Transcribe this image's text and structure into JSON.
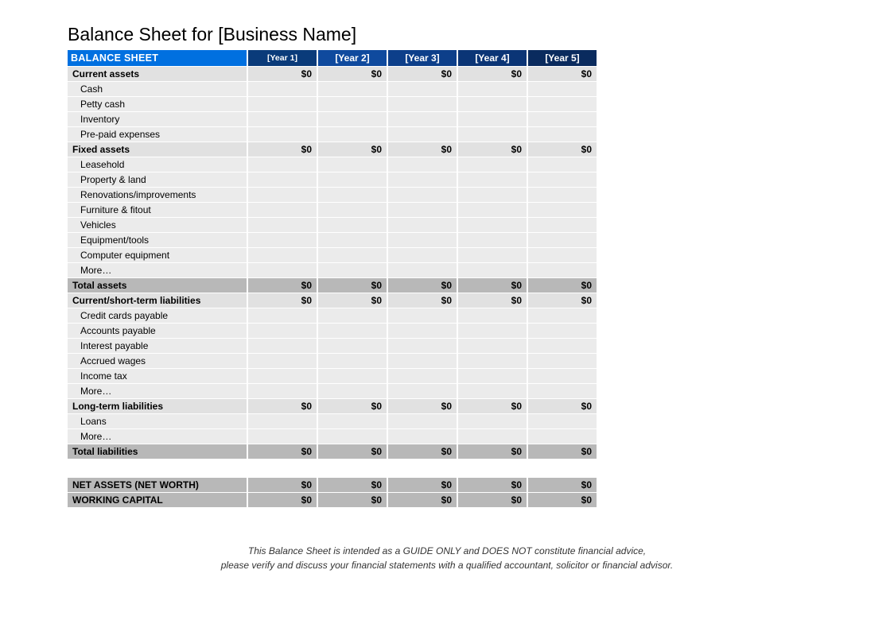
{
  "title": "Balance Sheet for [Business Name]",
  "header": {
    "main": "BALANCE SHEET",
    "years": [
      "[Year 1]",
      "[Year 2]",
      "[Year 3]",
      "[Year 4]",
      "[Year 5]"
    ]
  },
  "rows": [
    {
      "type": "section",
      "label": "Current assets",
      "values": [
        "$0",
        "$0",
        "$0",
        "$0",
        "$0"
      ]
    },
    {
      "type": "item",
      "label": "Cash",
      "values": [
        "",
        "",
        "",
        "",
        ""
      ]
    },
    {
      "type": "item",
      "label": "Petty cash",
      "values": [
        "",
        "",
        "",
        "",
        ""
      ]
    },
    {
      "type": "item",
      "label": "Inventory",
      "values": [
        "",
        "",
        "",
        "",
        ""
      ]
    },
    {
      "type": "item",
      "label": "Pre-paid expenses",
      "values": [
        "",
        "",
        "",
        "",
        ""
      ]
    },
    {
      "type": "section",
      "label": "Fixed assets",
      "values": [
        "$0",
        "$0",
        "$0",
        "$0",
        "$0"
      ]
    },
    {
      "type": "item",
      "label": "Leasehold",
      "values": [
        "",
        "",
        "",
        "",
        ""
      ]
    },
    {
      "type": "item",
      "label": "Property & land",
      "values": [
        "",
        "",
        "",
        "",
        ""
      ]
    },
    {
      "type": "item",
      "label": "Renovations/improvements",
      "values": [
        "",
        "",
        "",
        "",
        ""
      ]
    },
    {
      "type": "item",
      "label": "Furniture & fitout",
      "values": [
        "",
        "",
        "",
        "",
        ""
      ]
    },
    {
      "type": "item",
      "label": "Vehicles",
      "values": [
        "",
        "",
        "",
        "",
        ""
      ]
    },
    {
      "type": "item",
      "label": "Equipment/tools",
      "values": [
        "",
        "",
        "",
        "",
        ""
      ]
    },
    {
      "type": "item",
      "label": "Computer equipment",
      "values": [
        "",
        "",
        "",
        "",
        ""
      ]
    },
    {
      "type": "item",
      "label": "More…",
      "values": [
        "",
        "",
        "",
        "",
        ""
      ]
    },
    {
      "type": "total",
      "label": "Total assets",
      "values": [
        "$0",
        "$0",
        "$0",
        "$0",
        "$0"
      ]
    },
    {
      "type": "section",
      "label": "Current/short-term liabilities",
      "values": [
        "$0",
        "$0",
        "$0",
        "$0",
        "$0"
      ]
    },
    {
      "type": "item",
      "label": "Credit cards payable",
      "values": [
        "",
        "",
        "",
        "",
        ""
      ]
    },
    {
      "type": "item",
      "label": "Accounts payable",
      "values": [
        "",
        "",
        "",
        "",
        ""
      ]
    },
    {
      "type": "item",
      "label": "Interest payable",
      "values": [
        "",
        "",
        "",
        "",
        ""
      ]
    },
    {
      "type": "item",
      "label": "Accrued wages",
      "values": [
        "",
        "",
        "",
        "",
        ""
      ]
    },
    {
      "type": "item",
      "label": "Income tax",
      "values": [
        "",
        "",
        "",
        "",
        ""
      ]
    },
    {
      "type": "item",
      "label": "More…",
      "values": [
        "",
        "",
        "",
        "",
        ""
      ]
    },
    {
      "type": "section",
      "label": "Long-term liabilities",
      "values": [
        "$0",
        "$0",
        "$0",
        "$0",
        "$0"
      ]
    },
    {
      "type": "item",
      "label": "Loans",
      "values": [
        "",
        "",
        "",
        "",
        ""
      ]
    },
    {
      "type": "item",
      "label": "More…",
      "values": [
        "",
        "",
        "",
        "",
        ""
      ]
    },
    {
      "type": "total",
      "label": "Total liabilities",
      "values": [
        "$0",
        "$0",
        "$0",
        "$0",
        "$0"
      ]
    },
    {
      "type": "spacer",
      "label": "",
      "values": [
        "",
        "",
        "",
        "",
        ""
      ]
    },
    {
      "type": "summary",
      "label": "NET ASSETS (NET WORTH)",
      "values": [
        "$0",
        "$0",
        "$0",
        "$0",
        "$0"
      ]
    },
    {
      "type": "summary",
      "label": "WORKING CAPITAL",
      "values": [
        "$0",
        "$0",
        "$0",
        "$0",
        "$0"
      ]
    }
  ],
  "disclaimer": {
    "line1": "This Balance Sheet is intended as a GUIDE ONLY and DOES NOT constitute financial advice,",
    "line2": "please verify and discuss your financial statements with a qualified accountant, solicitor or financial advisor."
  }
}
